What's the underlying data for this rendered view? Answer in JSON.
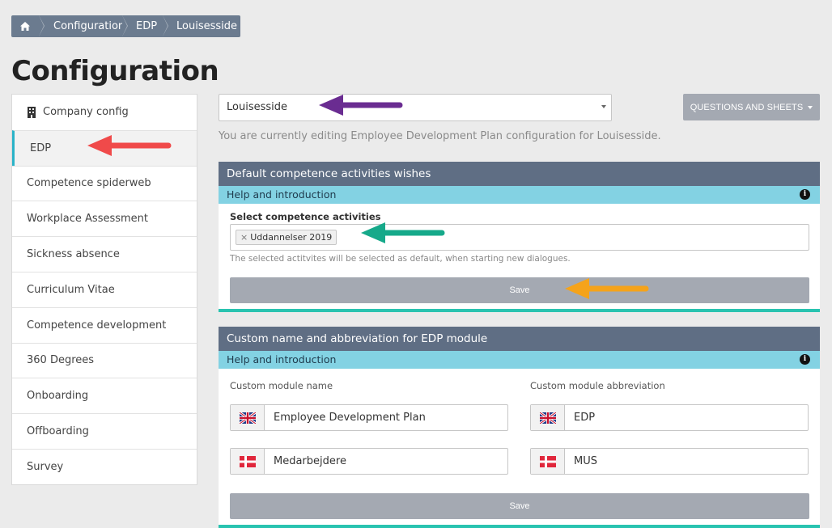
{
  "breadcrumb": {
    "items": [
      "Configuration",
      "EDP",
      "Louisesside"
    ]
  },
  "page": {
    "title": "Configuration"
  },
  "sidebar": {
    "items": [
      {
        "label": "Company config",
        "icon": "building-icon"
      },
      {
        "label": "EDP",
        "active": true
      },
      {
        "label": "Competence spiderweb"
      },
      {
        "label": "Workplace Assessment"
      },
      {
        "label": "Sickness absence"
      },
      {
        "label": "Curriculum Vitae"
      },
      {
        "label": "Competence development"
      },
      {
        "label": "360 Degrees"
      },
      {
        "label": "Onboarding"
      },
      {
        "label": "Offboarding"
      },
      {
        "label": "Survey"
      }
    ]
  },
  "main": {
    "company_select": "Louisesside",
    "questions_button": "QUESTIONS AND SHEETS",
    "editing_note": "You are currently editing Employee Development Plan configuration for Louisesside.",
    "panel1": {
      "title": "Default competence activities wishes",
      "help": "Help and introduction",
      "select_label": "Select competence activities",
      "tag": "Uddannelser 2019",
      "tag_remove": "×",
      "hint": "The selected actitvites will be selected as default, when starting new dialogues.",
      "save": "Save"
    },
    "panel2": {
      "title": "Custom name and abbreviation for EDP module",
      "help": "Help and introduction",
      "name_label": "Custom module name",
      "abbr_label": "Custom module abbreviation",
      "name_en": "Employee Development Plan",
      "name_da": "Medarbejdere",
      "abbr_en": "EDP",
      "abbr_da": "MUS",
      "save": "Save"
    }
  },
  "colors": {
    "header": "#5f6e84",
    "help_bar": "#83d2e3",
    "accent_bottom": "#29c3b0",
    "arrow_red": "#f04a4a",
    "arrow_purple": "#6a2c91",
    "arrow_teal": "#16a98a",
    "arrow_orange": "#f5a31a"
  }
}
